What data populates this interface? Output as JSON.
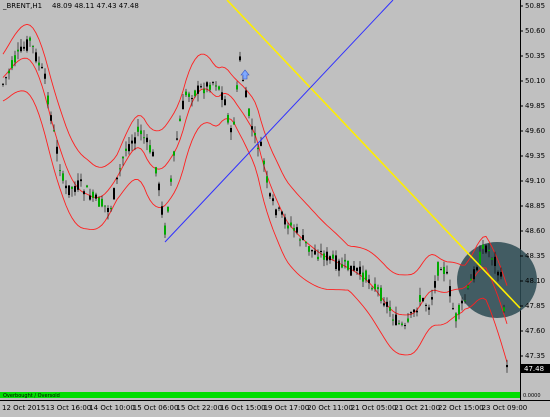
{
  "header": {
    "symbol_label": "_BRENT,H1",
    "ohlc_label": "48.09 48.11 47.43 47.48"
  },
  "price_axis": {
    "ticks": [
      "50.85",
      "50.60",
      "50.35",
      "50.10",
      "49.85",
      "49.60",
      "49.35",
      "49.10",
      "48.85",
      "48.60",
      "48.35",
      "48.10",
      "47.85",
      "47.60",
      "47.35"
    ],
    "current_price": "47.48"
  },
  "time_axis": {
    "ticks": [
      "12 Oct 2015",
      "13 Oct 16:00",
      "14 Oct 10:00",
      "15 Oct 06:00",
      "15 Oct 22:00",
      "16 Oct 15:00",
      "19 Oct 17:00",
      "20 Oct 11:00",
      "21 Oct 05:00",
      "21 Oct 21:00",
      "22 Oct 15:00",
      "23 Oct 09:00"
    ]
  },
  "indicator_pane": {
    "label": "Overbought / Oversold",
    "right_value": "0.0000"
  },
  "colors": {
    "background": "#c0c0c0",
    "candle_up": "#00aa00",
    "candle_down": "#000000",
    "bollinger": "#ff2020",
    "trendline_diagonal": "#ffee00",
    "trendline_support": "#3030ff",
    "highlight_ellipse": "#2b4a52",
    "indicator_bar": "#00dd00"
  },
  "markers": {
    "arrow_icon": "up-arrow-marker"
  }
}
